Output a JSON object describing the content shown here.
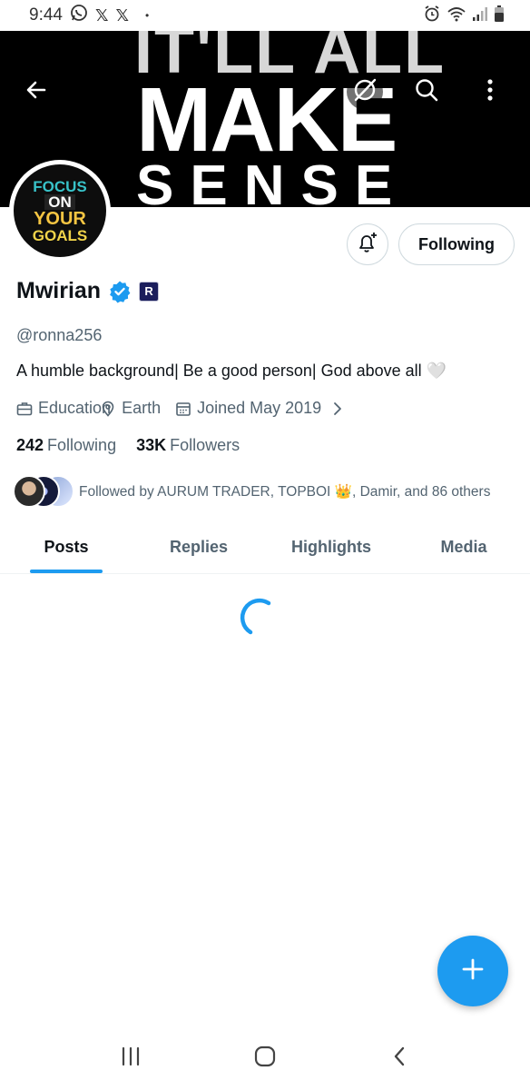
{
  "status_bar": {
    "time": "9:44",
    "notification_icons": [
      "whatsapp-icon",
      "x-icon",
      "x-icon"
    ],
    "dot": "•",
    "right_icons": [
      "alarm-icon",
      "wifi-icon",
      "signal-icon",
      "battery-icon"
    ]
  },
  "banner": {
    "line1": "IT'LL ALL",
    "line2": "MAKE",
    "line3": "SENSE"
  },
  "avatar": {
    "words": [
      "FOCUS",
      "ON",
      "YOUR",
      "GOALS"
    ]
  },
  "actions": {
    "following_label": "Following"
  },
  "profile": {
    "display_name": "Mwirian",
    "affiliate_badge": "R",
    "handle": "@ronna256",
    "bio": "A humble background| Be a good person| God above all 🤍",
    "category": "Education",
    "location": "Earth",
    "joined": "Joined May 2019",
    "following_count": "242",
    "following_label": "Following",
    "followers_count": "33K",
    "followers_label": "Followers",
    "followed_by": "Followed by AURUM TRADER, TOPBOI 👑, Damir, and 86 others"
  },
  "tabs": [
    {
      "label": "Posts",
      "active": true
    },
    {
      "label": "Replies",
      "active": false
    },
    {
      "label": "Highlights",
      "active": false
    },
    {
      "label": "Media",
      "active": false
    }
  ],
  "colors": {
    "accent": "#1d9bf0",
    "text_primary": "#0f1419",
    "text_secondary": "#536471",
    "border": "#cfd9de"
  }
}
